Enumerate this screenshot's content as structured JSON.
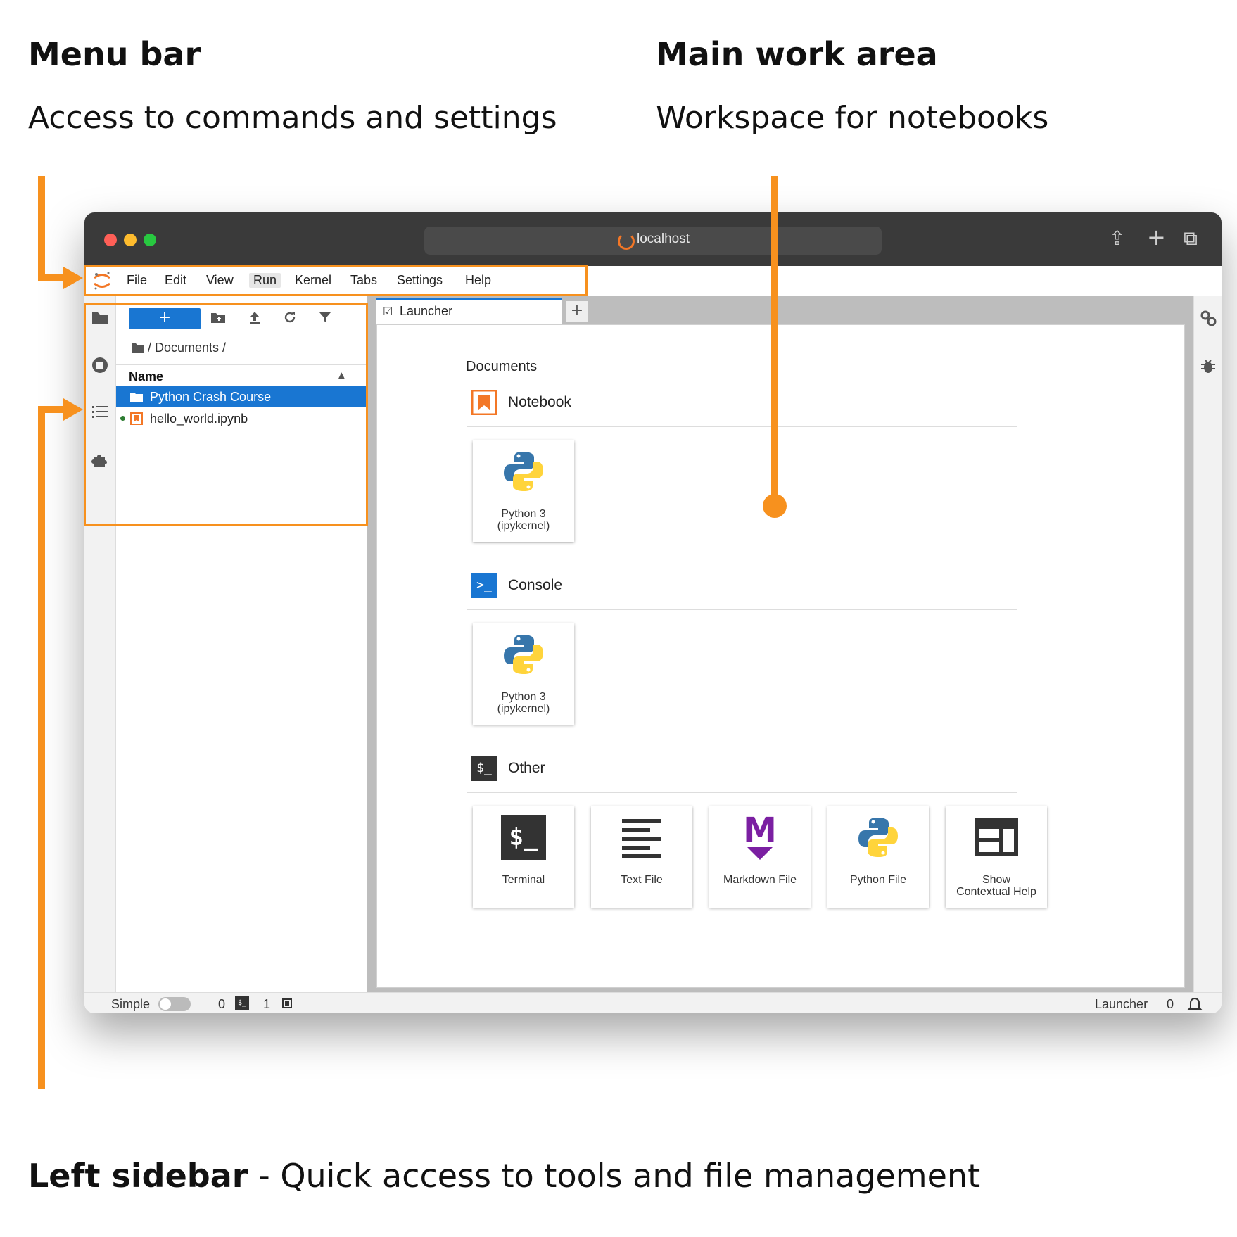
{
  "annotations": {
    "menu_bar": {
      "title": "Menu bar",
      "desc": "Access to commands and settings"
    },
    "main_work_area": {
      "title": "Main work area",
      "desc": "Workspace for notebooks"
    },
    "left_sidebar": {
      "title": "Left sidebar",
      "sep": " - ",
      "desc": "Quick access to tools and file management"
    },
    "accent_color": "#f7911e"
  },
  "browser": {
    "url": "localhost",
    "traffic_lights": [
      "#ff5f57",
      "#febc2e",
      "#28c840"
    ],
    "toolbar_icons": [
      "share-icon",
      "plus-icon",
      "tabs-icon"
    ]
  },
  "menubar": {
    "items": [
      "File",
      "Edit",
      "View",
      "Run",
      "Kernel",
      "Tabs",
      "Settings",
      "Help"
    ]
  },
  "filebrowser": {
    "new_label": "+",
    "breadcrumb": "/ Documents /",
    "column_name": "Name",
    "files": [
      {
        "name": "Python Crash Course",
        "type": "folder",
        "selected": true
      },
      {
        "name": "hello_world.ipynb",
        "type": "notebook",
        "running": true
      }
    ]
  },
  "tabs": [
    {
      "label": "Launcher",
      "active": true
    }
  ],
  "tab_add_label": "+",
  "launcher": {
    "path": "Documents",
    "sections": [
      {
        "title": "Notebook",
        "cards": [
          {
            "line1": "Python 3",
            "line2": "(ipykernel)"
          }
        ]
      },
      {
        "title": "Console",
        "cards": [
          {
            "line1": "Python 3",
            "line2": "(ipykernel)"
          }
        ]
      },
      {
        "title": "Other",
        "cards": [
          {
            "line1": "Terminal",
            "line2": ""
          },
          {
            "line1": "Text File",
            "line2": ""
          },
          {
            "line1": "Markdown File",
            "line2": ""
          },
          {
            "line1": "Python File",
            "line2": ""
          },
          {
            "line1": "Show",
            "line2": "Contextual Help"
          }
        ]
      }
    ],
    "terminal_glyph": "$_",
    "markdown_glyph": "M",
    "console_glyph": ">_",
    "other_glyph": "$_"
  },
  "statusbar": {
    "simple_label": "Simple",
    "terminals_count": "0",
    "kernels_count": "1",
    "terminal_icon_glyph": "$_",
    "right_label": "Launcher",
    "right_count": "0"
  }
}
